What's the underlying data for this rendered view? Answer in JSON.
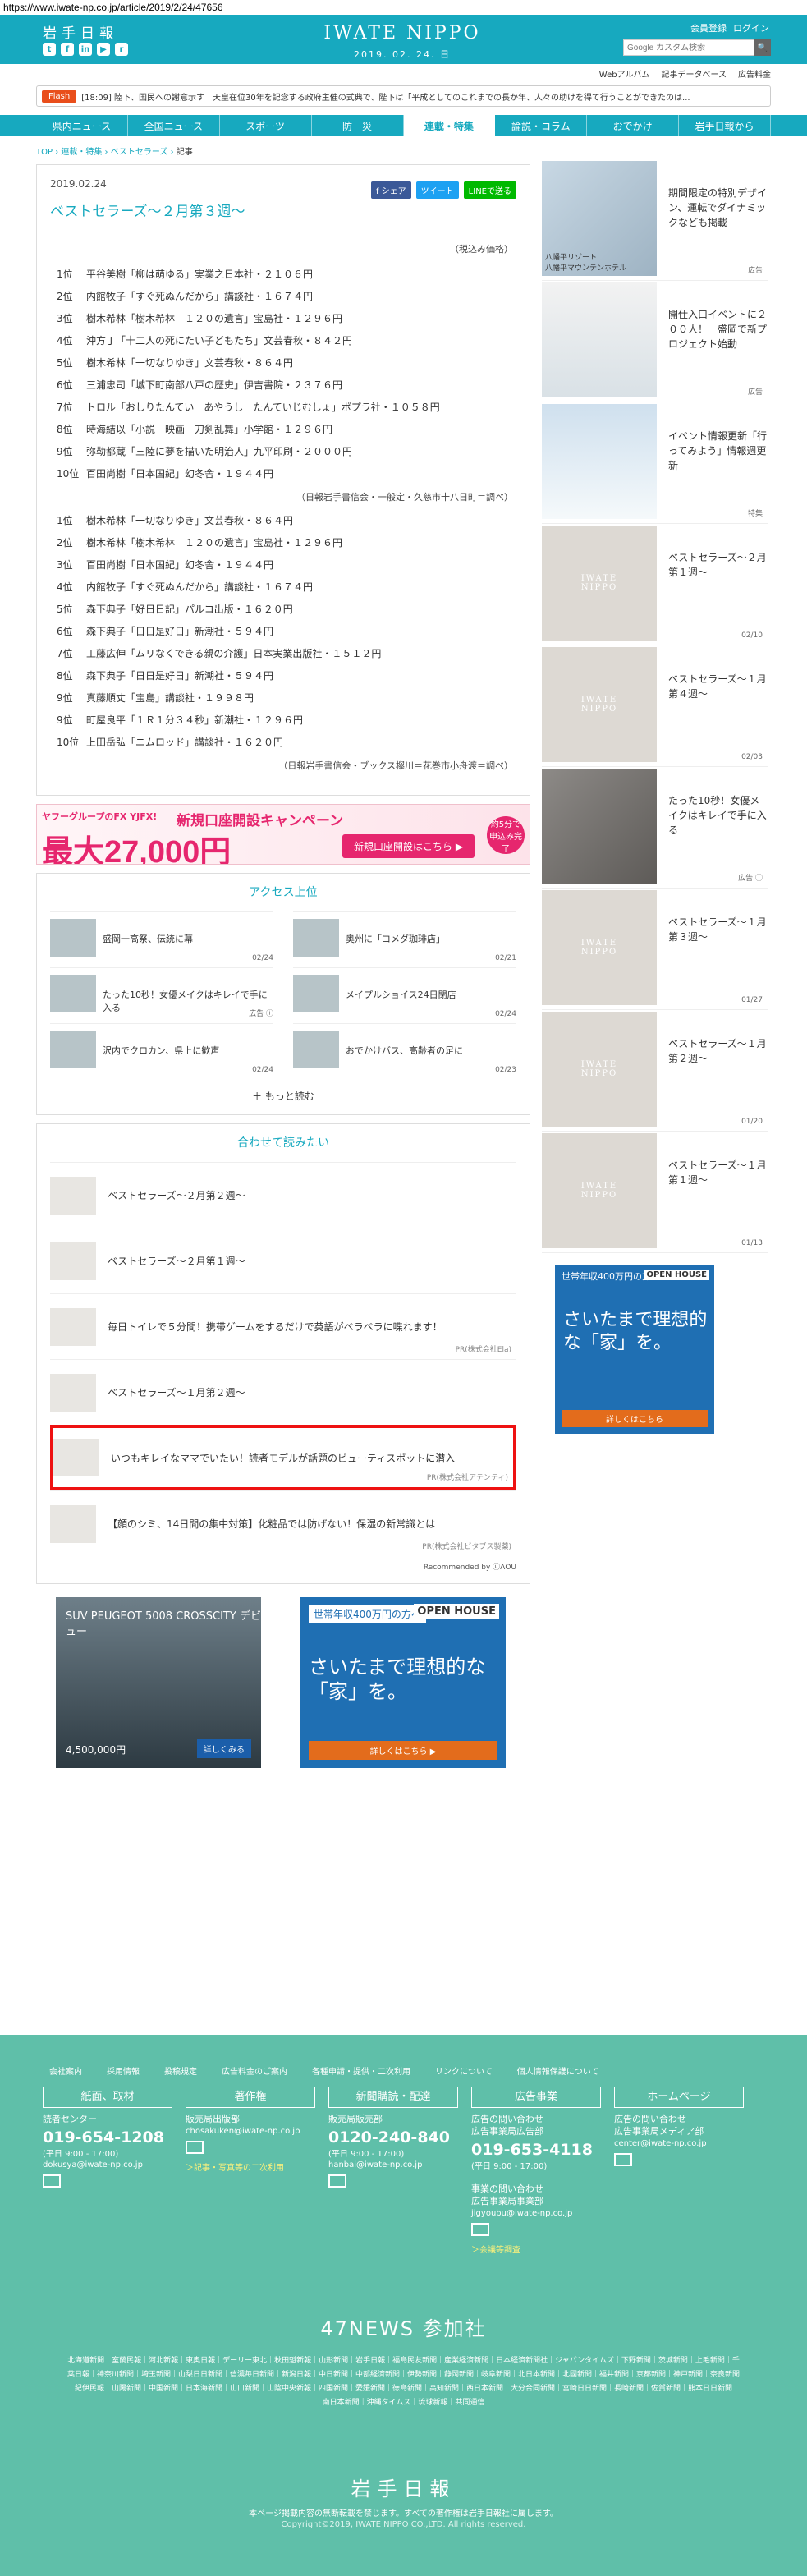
{
  "url": "https://www.iwate-np.co.jp/article/2019/2/24/47656",
  "header": {
    "brand_jp": "岩手日報",
    "logo_en": "IWATE NIPPO",
    "date": "2019. 02. 24.  日",
    "register": "会員登録",
    "login": "ログイン",
    "search_placeholder": "Google カスタム検索",
    "search_button": "🔍",
    "social": [
      "t",
      "f",
      "in",
      "▶",
      "r"
    ]
  },
  "subnav": [
    "Webアルバム",
    "記事データベース",
    "広告料金"
  ],
  "flash": {
    "label": "Flash",
    "text": "[18:09] 陸下、国民への謝意示す　天皇在位30年を記念する政府主催の式典で、陛下は「平成としてのこれまでの長か年、人々の助けを得て行うことができたのは..."
  },
  "gnav": [
    "県内ニュース",
    "全国ニュース",
    "スポーツ",
    "防　災",
    "連載・特集",
    "論説・コラム",
    "おでかけ",
    "岩手日報から"
  ],
  "gnav_active": 4,
  "breadcrumb": {
    "items": [
      "TOP",
      "連載・特集",
      "ベストセラーズ"
    ],
    "current": "記事"
  },
  "article": {
    "date": "2019.02.24",
    "title": "ベストセラーズ～２月第３週～",
    "share": {
      "fb": "f シェア",
      "tw": "ツイート",
      "line": "LINEで送る"
    },
    "note": "（税込み価格）",
    "ranking1": [
      {
        "rank": "1位",
        "text": "平谷美樹「柳は萌ゆる」実業之日本社・２１０６円"
      },
      {
        "rank": "2位",
        "text": "内館牧子「すぐ死ぬんだから」講談社・１６７４円"
      },
      {
        "rank": "3位",
        "text": "樹木希林「樹木希林　１２０の遺言」宝島社・１２９６円"
      },
      {
        "rank": "4位",
        "text": "沖方丁「十二人の死にたい子どもたち」文芸春秋・８４２円"
      },
      {
        "rank": "5位",
        "text": "樹木希林「一切なりゆき」文芸春秋・８６４円"
      },
      {
        "rank": "6位",
        "text": "三浦忠司「城下町南部八戸の歴史」伊吉書院・２３７６円"
      },
      {
        "rank": "7位",
        "text": "トロル「おしりたんてい　あやうし　たんていじむしょ」ポプラ社・１０５８円"
      },
      {
        "rank": "8位",
        "text": "時海結以「小説　映画　刀剣乱舞」小学館・１２９６円"
      },
      {
        "rank": "9位",
        "text": "弥勒都蔵「三陸に夢を描いた明治人」九平印刷・２０００円"
      },
      {
        "rank": "10位",
        "text": "百田尚樹「日本国紀」幻冬舎・１９４４円"
      }
    ],
    "source1": "（日報岩手書信会・一般定・久慈市十八日町＝調べ）",
    "ranking2": [
      {
        "rank": "1位",
        "text": "樹木希林「一切なりゆき」文芸春秋・８６４円"
      },
      {
        "rank": "2位",
        "text": "樹木希林「樹木希林　１２０の遺言」宝島社・１２９６円"
      },
      {
        "rank": "3位",
        "text": "百田尚樹「日本国紀」幻冬舎・１９４４円"
      },
      {
        "rank": "4位",
        "text": "内館牧子「すぐ死ぬんだから」講談社・１６７４円"
      },
      {
        "rank": "5位",
        "text": "森下典子「好日日記」パルコ出版・１６２０円"
      },
      {
        "rank": "6位",
        "text": "森下典子「日日是好日」新潮社・５９４円"
      },
      {
        "rank": "7位",
        "text": "工藤広伸「ムリなくできる親の介護」日本実業出版社・１５１２円"
      },
      {
        "rank": "8位",
        "text": "森下典子「日日是好日」新潮社・５９４円"
      },
      {
        "rank": "9位",
        "text": "真藤順丈「宝島」講談社・１９９８円"
      },
      {
        "rank": "9位",
        "text": "町屋良平「１Ｒ１分３４秒」新潮社・１２９６円"
      },
      {
        "rank": "10位",
        "text": "上田岳弘「ニムロッド」講談社・１６２０円"
      }
    ],
    "source2": "（日報岩手書信会・ブックス欅川＝花巻市小舟渡＝調べ）"
  },
  "banner": {
    "line1": "ヤフーグループのFX  YJFX!",
    "line2": "新規口座開設キャンペーン",
    "amount": "最大27,000円",
    "cta": "新規口座開設はこちら ▶",
    "badge": "約5分で申込み完了"
  },
  "access": {
    "title": "アクセス上位",
    "items": [
      {
        "title": "盛岡一高祭、伝統に幕",
        "date": "02/24"
      },
      {
        "title": "奥州に「コメダ珈琲店」",
        "date": "02/21"
      },
      {
        "title": "たった10秒！女優メイクはキレイで手に入る",
        "date": "広告 ⓘ"
      },
      {
        "title": "メイプルショイス24日閉店",
        "date": "02/24"
      },
      {
        "title": "沢内でクロカン、県上に歓声",
        "date": "02/24"
      },
      {
        "title": "おでかけバス、高齢者の足に",
        "date": "02/23"
      }
    ],
    "more": "＋ もっと読む"
  },
  "recommend": {
    "title": "合わせて読みたい",
    "items": [
      {
        "title": "ベストセラーズ～２月第２週～",
        "pr": ""
      },
      {
        "title": "ベストセラーズ～２月第１週～",
        "pr": ""
      },
      {
        "title": "毎日トイレで５分間！携帯ゲームをするだけで英語がペラペラに喋れます！",
        "pr": "PR(株式会社Ela)"
      },
      {
        "title": "ベストセラーズ～１月第２週～",
        "pr": ""
      },
      {
        "title": "いつもキレイなママでいたい！読者モデルが話題のビューティスポットに潜入",
        "pr": "PR(株式会社アテンティ)"
      },
      {
        "title": "【顔のシミ、14日間の集中対策】化粧品では防げない！保湿の新常識とは",
        "pr": "PR(株式会社ビタブス製薬)"
      }
    ],
    "footer": "Recommended by  ⓤΛOU"
  },
  "bottom_ads": {
    "car": {
      "name": "SUV PEUGEOT 5008 CROSSCITY デビュー",
      "price": "4,500,000円",
      "cta": "詳しくみる"
    },
    "house": {
      "badge": "世帯年収400万円の方へ",
      "brand": "OPEN HOUSE",
      "copy": "さいたまで理想的な「家」を。",
      "cta": "詳しくはこちら ▶"
    }
  },
  "side": {
    "items": [
      {
        "title": "期間限定の特別デザイン、運転でダイナミックなども掲載",
        "meta": "広告",
        "sub": "八幡平リゾート\n八幡平マウンテンホテル"
      },
      {
        "title": "開仕入口イベントに２００人！　盛岡で新プロジェクト始動",
        "meta": "広告"
      },
      {
        "title": "イベント情報更新「行ってみよう」情報週更新",
        "meta": "特集"
      },
      {
        "title": "ベストセラーズ～２月第１週～",
        "meta": "02/10"
      },
      {
        "title": "ベストセラーズ～１月第４週～",
        "meta": "02/03"
      },
      {
        "title": "たった10秒！女優メイクはキレイで手に入る",
        "meta": "広告 ⓘ"
      },
      {
        "title": "ベストセラーズ～１月第３週～",
        "meta": "01/27"
      },
      {
        "title": "ベストセラーズ～１月第２週～",
        "meta": "01/20"
      },
      {
        "title": "ベストセラーズ～１月第１週～",
        "meta": "01/13"
      }
    ],
    "logo_text": "IWATE\nNIPPO",
    "ad": {
      "badge": "世帯年収400万円の方へ",
      "brand": "OPEN HOUSE",
      "copy": "さいたまで理想的な「家」を。",
      "cta": "詳しくはこちら"
    }
  },
  "footer": {
    "links": [
      "会社案内",
      "採用情報",
      "投稿規定",
      "広告料金のご案内",
      "各種申請・提供・二次利用",
      "リンクについて",
      "個人情報保護について"
    ],
    "cols": [
      {
        "head": "紙面、取材",
        "label": "読者センター",
        "phone": "019-654-1208",
        "hours": "(平日 9:00 - 17:00)",
        "mail": "dokusya@iwate-np.co.jp",
        "extra": ""
      },
      {
        "head": "著作権",
        "label": "販売局出版部",
        "phone": "",
        "hours": "",
        "mail": "chosakuken@iwate-np.co.jp",
        "extra": "＞記事・写真等の二次利用"
      },
      {
        "head": "新聞購読・配達",
        "label": "販売局販売部",
        "phone": "0120-240-840",
        "hours": "(平日 9:00 - 17:00)",
        "mail": "hanbai@iwate-np.co.jp",
        "extra": ""
      },
      {
        "head": "広告事業",
        "label": "広告の問い合わせ\n広告事業局広告部",
        "phone": "019-653-4118",
        "hours": "(平日 9:00 - 17:00)",
        "mail": "jigyoubu@iwate-np.co.jp",
        "extra": "＞会議等調査"
      },
      {
        "head": "ホームページ",
        "label": "広告の問い合わせ\n広告事業局メディア部",
        "phone": "",
        "hours": "",
        "mail": "center@iwate-np.co.jp",
        "extra": ""
      }
    ],
    "col4_extra_label": "事業の問い合わせ\n広告事業局事業部",
    "news47": "47NEWS 参加社",
    "papers": "北海道新聞｜室蘭民報｜河北新報｜東奥日報｜デーリー東北｜秋田魁新報｜山形新聞｜岩手日報｜福島民友新聞｜産業経済新聞｜日本経済新聞社｜ジャパンタイムズ｜下野新聞｜茨城新聞｜上毛新聞｜千葉日報｜神奈川新聞｜埼玉新聞｜山梨日日新聞｜信濃毎日新聞｜新潟日報｜中日新聞｜中部経済新聞｜伊勢新聞｜静岡新聞｜岐阜新聞｜北日本新聞｜北國新聞｜福井新聞｜京都新聞｜神戸新聞｜奈良新聞｜紀伊民報｜山陽新聞｜中国新聞｜日本海新聞｜山口新聞｜山陰中央新報｜四国新聞｜愛媛新聞｜徳島新聞｜高知新聞｜西日本新聞｜大分合同新聞｜宮崎日日新聞｜長崎新聞｜佐賀新聞｜熊本日日新聞｜南日本新聞｜沖縄タイムス｜琉球新報｜共同通信",
    "brand": "岩手日報",
    "copy1": "本ページ掲載内容の無断転載を禁じます。すべての著作権は岩手日報社に属します。",
    "copy2": "Copyright©2019, IWATE NIPPO CO.,LTD. All rights reserved."
  }
}
